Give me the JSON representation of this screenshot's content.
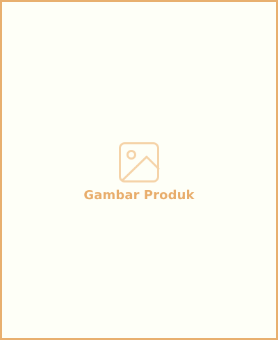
{
  "product_image": {
    "placeholder_label": "Gambar Produk",
    "icon": "image-icon"
  },
  "colors": {
    "border": "#e8b06f",
    "background": "#fefff7",
    "icon_stroke": "#f5d3a8",
    "label": "#e8ad6b"
  }
}
